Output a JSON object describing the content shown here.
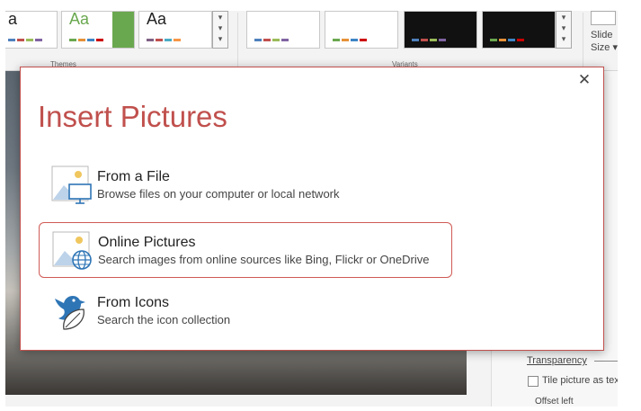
{
  "background_app": {
    "ribbon": {
      "themes_group_label": "Themes",
      "variants_group_label": "Variants",
      "theme_thumbs": [
        "a",
        "Aa",
        "Aa"
      ],
      "slide_size_label_line1": "Slide",
      "slide_size_label_line2": "Size ▾"
    },
    "right_pane": {
      "transparency_label": "Transparency",
      "tile_picture_label": "Tile picture as tex",
      "offset_left_label": "Offset left"
    }
  },
  "dialog": {
    "title": "Insert Pictures",
    "close_glyph": "✕",
    "options": [
      {
        "title": "From a File",
        "description": "Browse files on your computer or local network",
        "icon": "picture-monitor-icon"
      },
      {
        "title": "Online Pictures",
        "description": "Search images from online sources like Bing, Flickr or OneDrive",
        "icon": "picture-globe-icon"
      },
      {
        "title": "From Icons",
        "description": "Search the icon collection",
        "icon": "bird-leaf-icon"
      }
    ]
  },
  "colors": {
    "accent_red": "#c0504d",
    "icon_blue": "#2e75b6",
    "icon_yellow": "#f0c75e"
  }
}
